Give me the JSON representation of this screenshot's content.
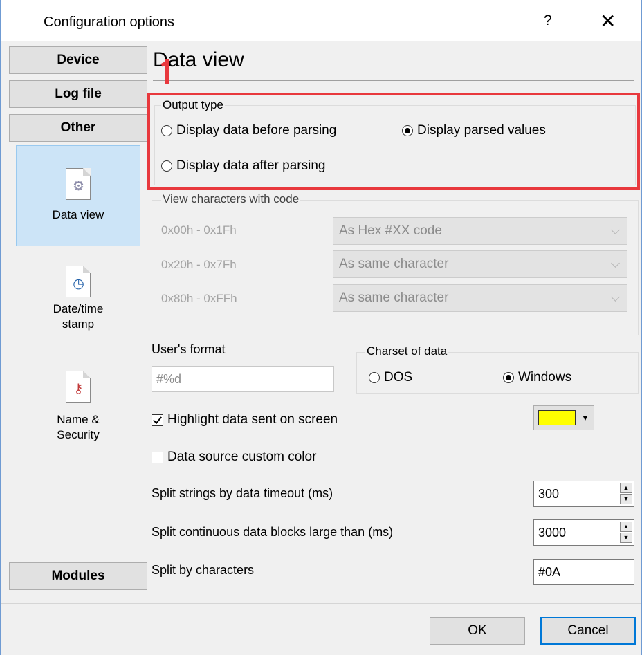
{
  "window": {
    "title": "Configuration options",
    "help_label": "?",
    "close_label": "✕"
  },
  "nav": {
    "device": "Device",
    "log_file": "Log file",
    "other": "Other",
    "modules": "Modules",
    "items": [
      {
        "label": "Data view",
        "icon": "gear-document-icon"
      },
      {
        "label": "Date/time stamp",
        "icon": "clock-document-icon"
      },
      {
        "label": "Name & Security",
        "icon": "keys-document-icon"
      }
    ]
  },
  "page": {
    "title": "Data view"
  },
  "output_type": {
    "legend": "Output type",
    "before": "Display data before parsing",
    "parsed": "Display parsed values",
    "after": "Display data after parsing",
    "selected": "parsed"
  },
  "view_chars": {
    "legend": "View characters with code",
    "rows": [
      {
        "range": "0x00h - 0x1Fh",
        "value": "As Hex #XX code"
      },
      {
        "range": "0x20h - 0x7Fh",
        "value": "As same character"
      },
      {
        "range": "0x80h - 0xFFh",
        "value": "As same character"
      }
    ]
  },
  "users_format": {
    "label": "User's format",
    "value": "#%d"
  },
  "charset": {
    "legend": "Charset of data",
    "dos": "DOS",
    "windows": "Windows",
    "selected": "windows"
  },
  "highlight": {
    "label": "Highlight data sent on screen",
    "checked": true,
    "color": "#ffff00"
  },
  "custom_color": {
    "label": "Data source custom color",
    "checked": false
  },
  "split_timeout": {
    "label": "Split strings by data timeout (ms)",
    "value": "300"
  },
  "split_blocks": {
    "label": "Split continuous data blocks large than (ms)",
    "value": "3000"
  },
  "split_chars": {
    "label": "Split by characters",
    "value": "#0A"
  },
  "buttons": {
    "ok": "OK",
    "cancel": "Cancel"
  },
  "colors": {
    "annotation": "#e8383d",
    "selection": "#cce4f7",
    "accent": "#0078d7"
  }
}
